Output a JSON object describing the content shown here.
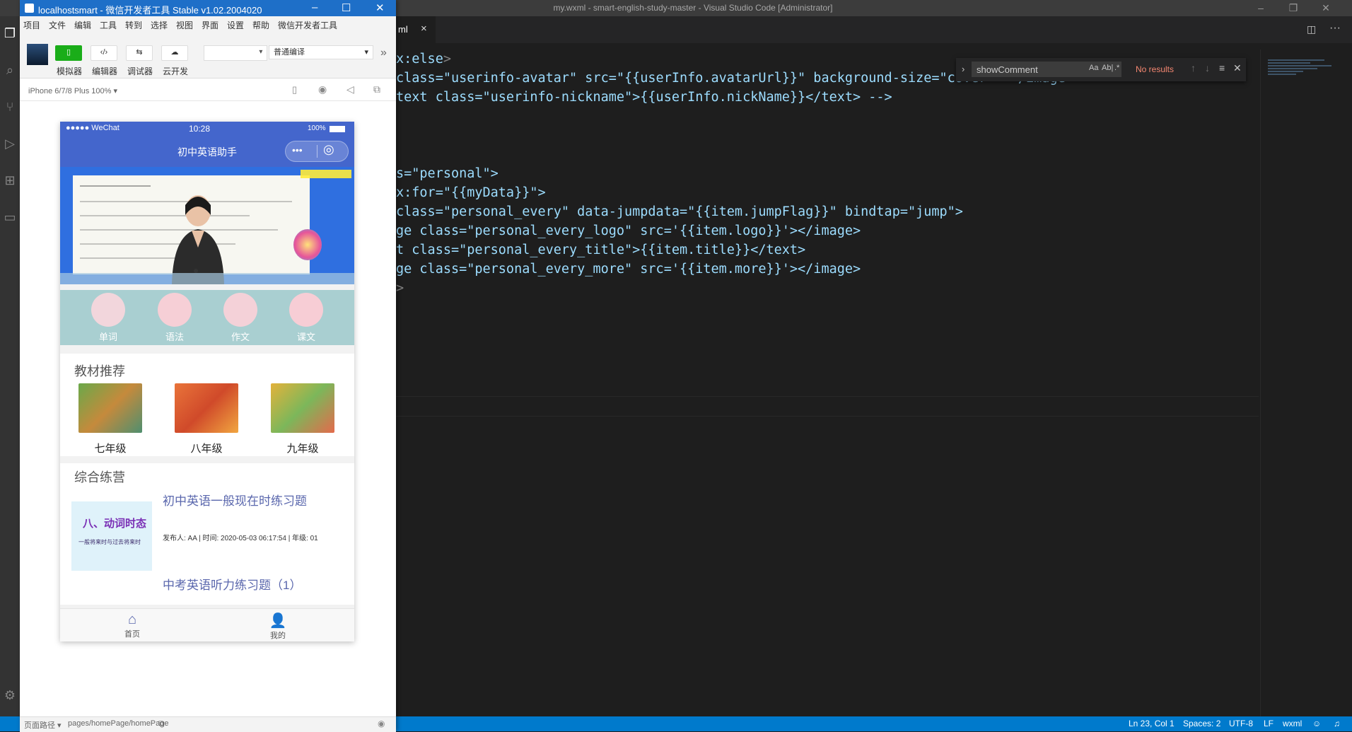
{
  "vscode": {
    "title": "my.wxml - smart-english-study-master - Visual Studio Code [Administrator]",
    "tab_label": "ml",
    "find": {
      "query": "showComment",
      "result": "No results",
      "opt_case": "Aa",
      "opt_word": "Ab|",
      "opt_regex": ".*"
    },
    "status": {
      "position": "Ln 23, Col 1",
      "spaces": "Spaces: 2",
      "encoding": "UTF-8",
      "eol": "LF",
      "language": "wxml"
    },
    "code_lines": [
      [
        "x:else",
        ">"
      ],
      [
        "class=\"userinfo-avatar\" src=\"{{userInfo.avatarUrl}}\" background-size=\"cover\" ></image>"
      ],
      [
        "text class=\"userinfo-nickname\">{{userInfo.nickName}}</text> -->"
      ],
      [
        "s=\"personal\">"
      ],
      [
        "x:for=\"{{myData}}\">"
      ],
      [
        "class=\"personal_every\" data-jumpdata=\"{{item.jumpFlag}}\" bindtap=\"jump\">"
      ],
      [
        "ge class=\"personal_every_logo\" src='{{item.logo}}'></image>"
      ],
      [
        "t class=\"personal_every_title\">{{item.title}}</text>"
      ],
      [
        "ge class=\"personal_every_more\" src='{{item.more}}'></image>"
      ],
      [
        ">"
      ]
    ]
  },
  "wechat": {
    "title": "localhostsmart - 微信开发者工具 Stable v1.02.2004020",
    "menu": [
      "项目",
      "文件",
      "编辑",
      "工具",
      "转到",
      "选择",
      "视图",
      "界面",
      "设置",
      "帮助",
      "微信开发者工具"
    ],
    "toolbar": {
      "simulator": "模拟器",
      "editor": "编辑器",
      "debugger": "调试器",
      "cloud": "云开发",
      "compile_mode": "普通编译"
    },
    "device": "iPhone 6/7/8 Plus 100% ▾",
    "phone": {
      "carrier": "●●●●● WeChat",
      "time": "10:28",
      "battery": "100%",
      "nav_title": "初中英语助手",
      "categories": [
        "单词",
        "语法",
        "作文",
        "课文"
      ],
      "textbook_title": "教材推荐",
      "textbooks": [
        "七年级",
        "八年级",
        "九年级"
      ],
      "practice_title": "综合练营",
      "practice_item": {
        "thumb_title": "八、动词时态",
        "thumb_sub": "一般将来时与过去将来时",
        "title": "初中英语一般现在时练习题",
        "meta": "发布人: AA | 时间: 2020-05-03 06:17:54 | 年级: 01"
      },
      "practice_item2_title": "中考英语听力练习题（1）",
      "tabs": [
        "首页",
        "我的"
      ]
    },
    "bottom": {
      "path_label": "页面路径 ▾",
      "path": "pages/homePage/homePage"
    }
  }
}
